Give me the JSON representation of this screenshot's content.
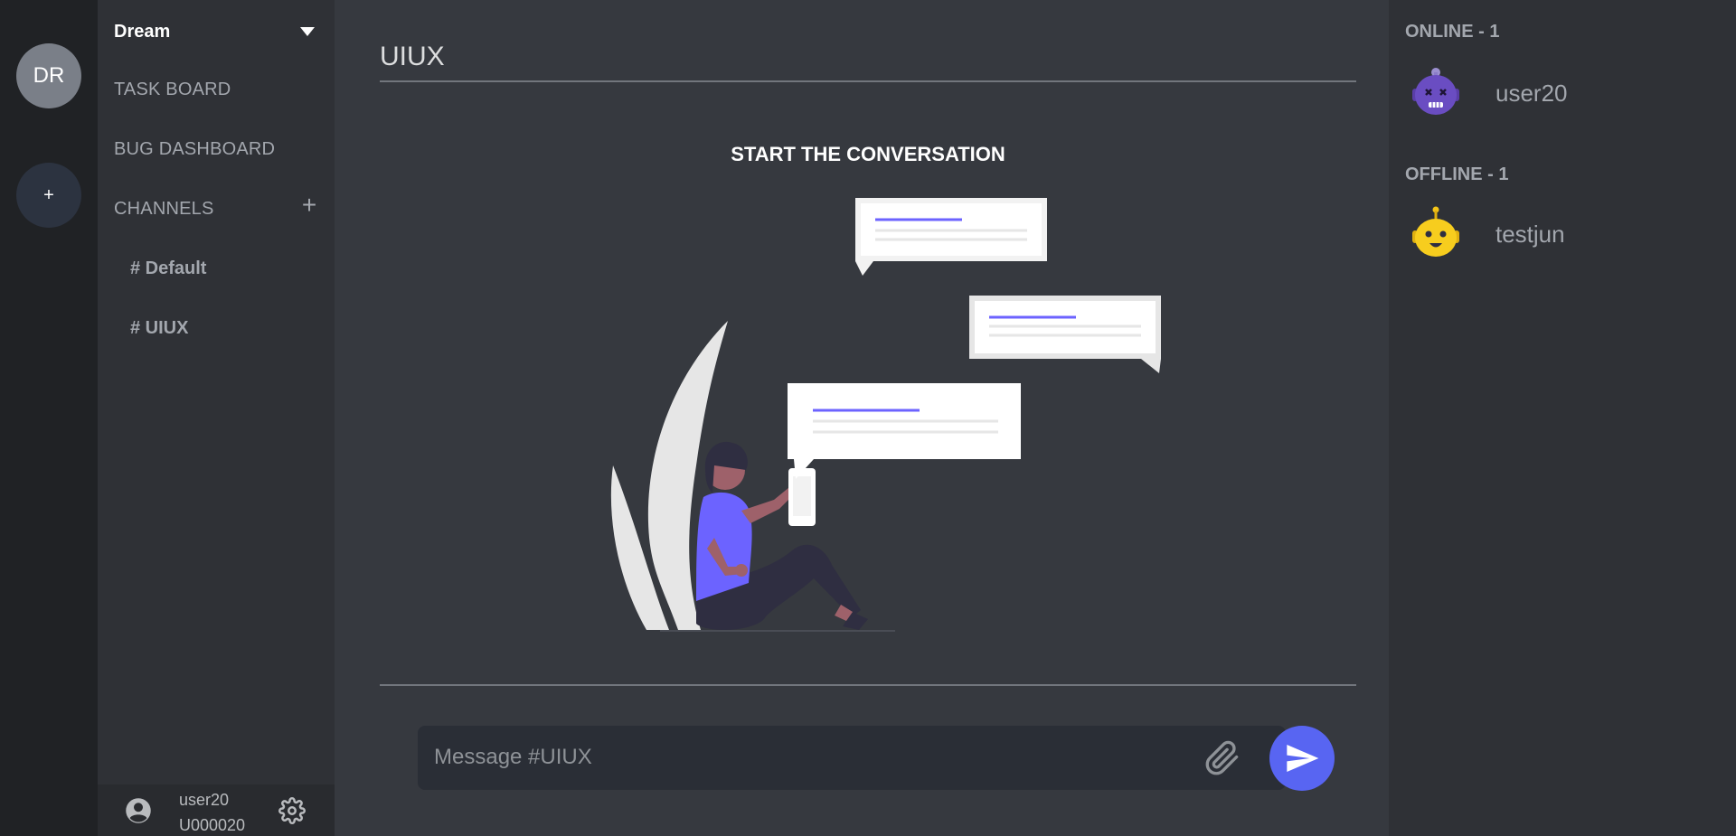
{
  "servers": [
    {
      "initials": "DR"
    },
    {
      "add_label": "+"
    }
  ],
  "sidebar": {
    "server_name": "Dream",
    "nav": {
      "task_board": "TASK BOARD",
      "bug_dashboard": "BUG DASHBOARD",
      "channels": "CHANNELS",
      "add_channel": "+"
    },
    "channels": [
      {
        "label": "# Default"
      },
      {
        "label": "# UIUX"
      }
    ]
  },
  "user_panel": {
    "username": "user20",
    "user_id": "U000020"
  },
  "main": {
    "channel_title": "UIUX",
    "empty_state": "START THE CONVERSATION",
    "composer": {
      "placeholder": "Message #UIUX"
    }
  },
  "members": {
    "online_title": "ONLINE - 1",
    "offline_title": "OFFLINE - 1",
    "online": [
      {
        "name": "user20",
        "avatar": "purple-robot-icon"
      }
    ],
    "offline": [
      {
        "name": "testjun",
        "avatar": "yellow-robot-icon"
      }
    ]
  },
  "colors": {
    "accent": "#5865f2",
    "rail": "#202225",
    "sidebar": "#2f3136",
    "main": "#36393f"
  }
}
